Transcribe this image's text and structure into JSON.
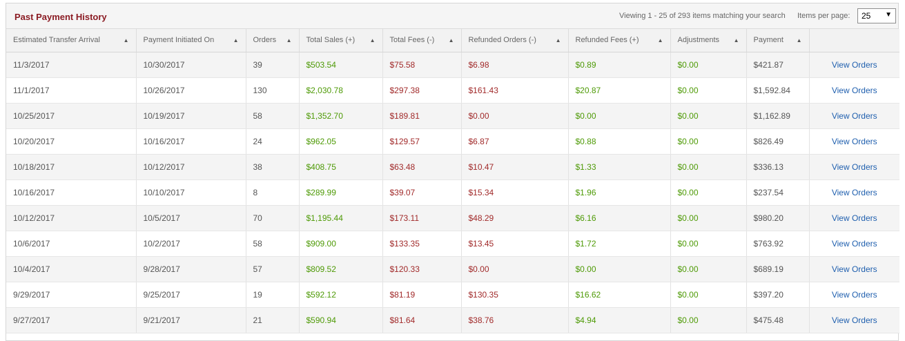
{
  "header": {
    "title": "Past Payment History",
    "viewing_text": "Viewing 1 - 25 of 293 items matching your search",
    "items_per_page_label": "Items per page:",
    "items_per_page_value": "25"
  },
  "columns": [
    "Estimated Transfer Arrival",
    "Payment Initiated On",
    "Orders",
    "Total Sales (+)",
    "Total Fees (-)",
    "Refunded Orders (-)",
    "Refunded Fees (+)",
    "Adjustments",
    "Payment",
    ""
  ],
  "sort_icon": "sort-asc-icon",
  "colors": {
    "positive": "#4e9a06",
    "negative": "#a12a2a",
    "link": "#1f5fae",
    "title": "#8b1c24"
  },
  "rows": [
    [
      "11/3/2017",
      "10/30/2017",
      "39",
      "$503.54",
      "$75.58",
      "$6.98",
      "$0.89",
      "$0.00",
      "$421.87",
      "View Orders"
    ],
    [
      "11/1/2017",
      "10/26/2017",
      "130",
      "$2,030.78",
      "$297.38",
      "$161.43",
      "$20.87",
      "$0.00",
      "$1,592.84",
      "View Orders"
    ],
    [
      "10/25/2017",
      "10/19/2017",
      "58",
      "$1,352.70",
      "$189.81",
      "$0.00",
      "$0.00",
      "$0.00",
      "$1,162.89",
      "View Orders"
    ],
    [
      "10/20/2017",
      "10/16/2017",
      "24",
      "$962.05",
      "$129.57",
      "$6.87",
      "$0.88",
      "$0.00",
      "$826.49",
      "View Orders"
    ],
    [
      "10/18/2017",
      "10/12/2017",
      "38",
      "$408.75",
      "$63.48",
      "$10.47",
      "$1.33",
      "$0.00",
      "$336.13",
      "View Orders"
    ],
    [
      "10/16/2017",
      "10/10/2017",
      "8",
      "$289.99",
      "$39.07",
      "$15.34",
      "$1.96",
      "$0.00",
      "$237.54",
      "View Orders"
    ],
    [
      "10/12/2017",
      "10/5/2017",
      "70",
      "$1,195.44",
      "$173.11",
      "$48.29",
      "$6.16",
      "$0.00",
      "$980.20",
      "View Orders"
    ],
    [
      "10/6/2017",
      "10/2/2017",
      "58",
      "$909.00",
      "$133.35",
      "$13.45",
      "$1.72",
      "$0.00",
      "$763.92",
      "View Orders"
    ],
    [
      "10/4/2017",
      "9/28/2017",
      "57",
      "$809.52",
      "$120.33",
      "$0.00",
      "$0.00",
      "$0.00",
      "$689.19",
      "View Orders"
    ],
    [
      "9/29/2017",
      "9/25/2017",
      "19",
      "$592.12",
      "$81.19",
      "$130.35",
      "$16.62",
      "$0.00",
      "$397.20",
      "View Orders"
    ],
    [
      "9/27/2017",
      "9/21/2017",
      "21",
      "$590.94",
      "$81.64",
      "$38.76",
      "$4.94",
      "$0.00",
      "$475.48",
      "View Orders"
    ]
  ]
}
